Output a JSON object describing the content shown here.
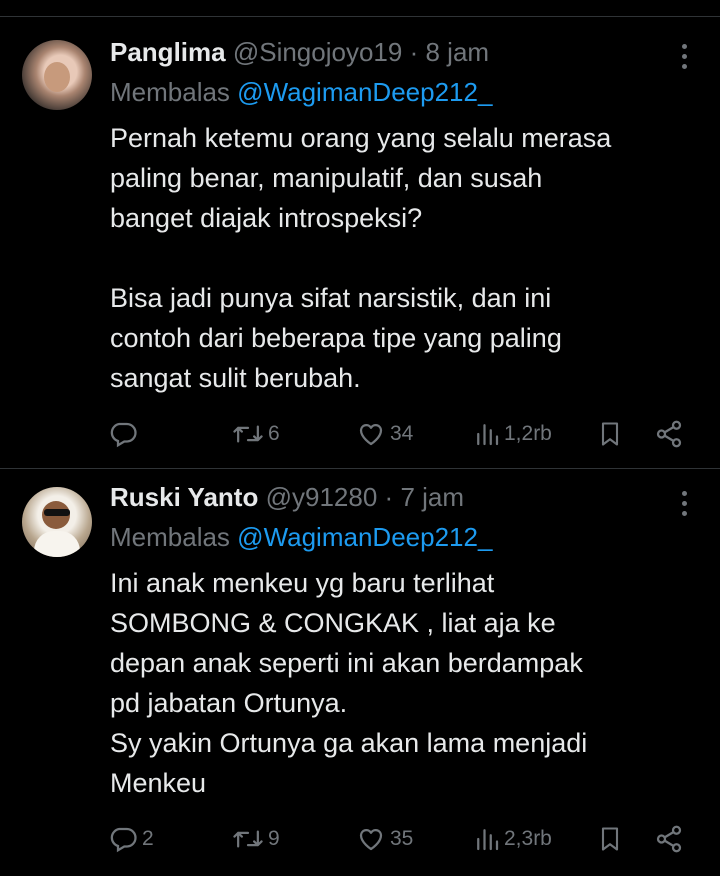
{
  "tweets": [
    {
      "name": "Panglima",
      "handle": "@Singojoyo19",
      "time": "8 jam",
      "replying_prefix": "Membalas",
      "replying_to": "@WagimanDeep212_",
      "text": "Pernah ketemu orang yang selalu merasa\npaling benar, manipulatif, dan susah\nbanget diajak introspeksi?\n\nBisa jadi punya sifat narsistik, dan ini\ncontoh dari beberapa tipe yang paling\nsangat sulit berubah.",
      "replies": "",
      "retweets": "6",
      "likes": "34",
      "views": "1,2rb"
    },
    {
      "name": "Ruski Yanto",
      "handle": "@y91280",
      "time": "7 jam",
      "replying_prefix": "Membalas",
      "replying_to": "@WagimanDeep212_",
      "text": "Ini anak menkeu yg baru terlihat\nSOMBONG & CONGKAK , liat aja ke\ndepan anak seperti ini akan berdampak\npd jabatan Ortunya.\nSy yakin Ortunya ga akan lama menjadi\nMenkeu",
      "replies": "2",
      "retweets": "9",
      "likes": "35",
      "views": "2,3rb"
    }
  ],
  "separator_dot": "·",
  "colors": {
    "background": "#000000",
    "text": "#e7e9ea",
    "muted": "#71767b",
    "link": "#1d9bf0",
    "divider": "#2f3336"
  },
  "icons": [
    "reply-icon",
    "retweet-icon",
    "like-icon",
    "views-icon",
    "bookmark-icon",
    "share-icon",
    "more-icon"
  ]
}
